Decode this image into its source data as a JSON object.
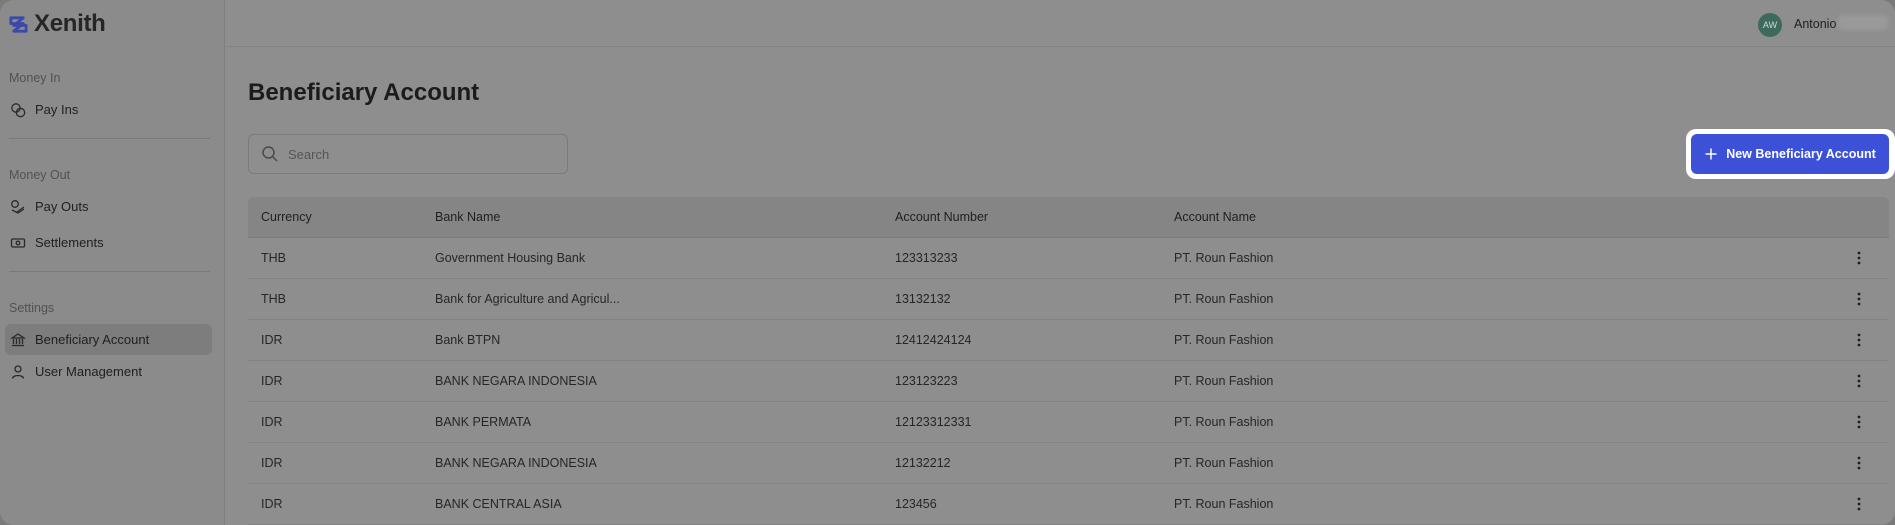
{
  "app": {
    "name": "Xenith"
  },
  "sidebar": {
    "sections": [
      {
        "label": "Money In"
      },
      {
        "label": "Money Out"
      },
      {
        "label": "Settings"
      }
    ],
    "items": [
      {
        "label": "Pay Ins",
        "icon": "coins-icon"
      },
      {
        "label": "Pay Outs",
        "icon": "send-money-icon"
      },
      {
        "label": "Settlements",
        "icon": "cash-icon"
      },
      {
        "label": "Beneficiary Account",
        "icon": "bank-icon",
        "active": true
      },
      {
        "label": "User Management",
        "icon": "user-icon"
      }
    ]
  },
  "header": {
    "avatar_initials": "AW",
    "user_name": "Antonio"
  },
  "main": {
    "title": "Beneficiary Account",
    "search_placeholder": "Search",
    "new_button_label": "New Beneficiary Account",
    "accent_color": "#3d51d8"
  },
  "table": {
    "columns": [
      "Currency",
      "Bank Name",
      "Account Number",
      "Account Name"
    ],
    "rows": [
      {
        "currency": "THB",
        "bank": "Government Housing Bank",
        "number": "123313233",
        "name": "PT. Roun Fashion"
      },
      {
        "currency": "THB",
        "bank": "Bank for Agriculture and Agricul...",
        "number": "13132132",
        "name": "PT. Roun Fashion"
      },
      {
        "currency": "IDR",
        "bank": "Bank BTPN",
        "number": "12412424124",
        "name": "PT. Roun Fashion"
      },
      {
        "currency": "IDR",
        "bank": "BANK NEGARA INDONESIA",
        "number": "123123223",
        "name": "PT. Roun Fashion"
      },
      {
        "currency": "IDR",
        "bank": "BANK PERMATA",
        "number": "12123312331",
        "name": "PT. Roun Fashion"
      },
      {
        "currency": "IDR",
        "bank": "BANK NEGARA INDONESIA",
        "number": "12132212",
        "name": "PT. Roun Fashion"
      },
      {
        "currency": "IDR",
        "bank": "BANK CENTRAL ASIA",
        "number": "123456",
        "name": "PT. Roun Fashion"
      }
    ]
  }
}
